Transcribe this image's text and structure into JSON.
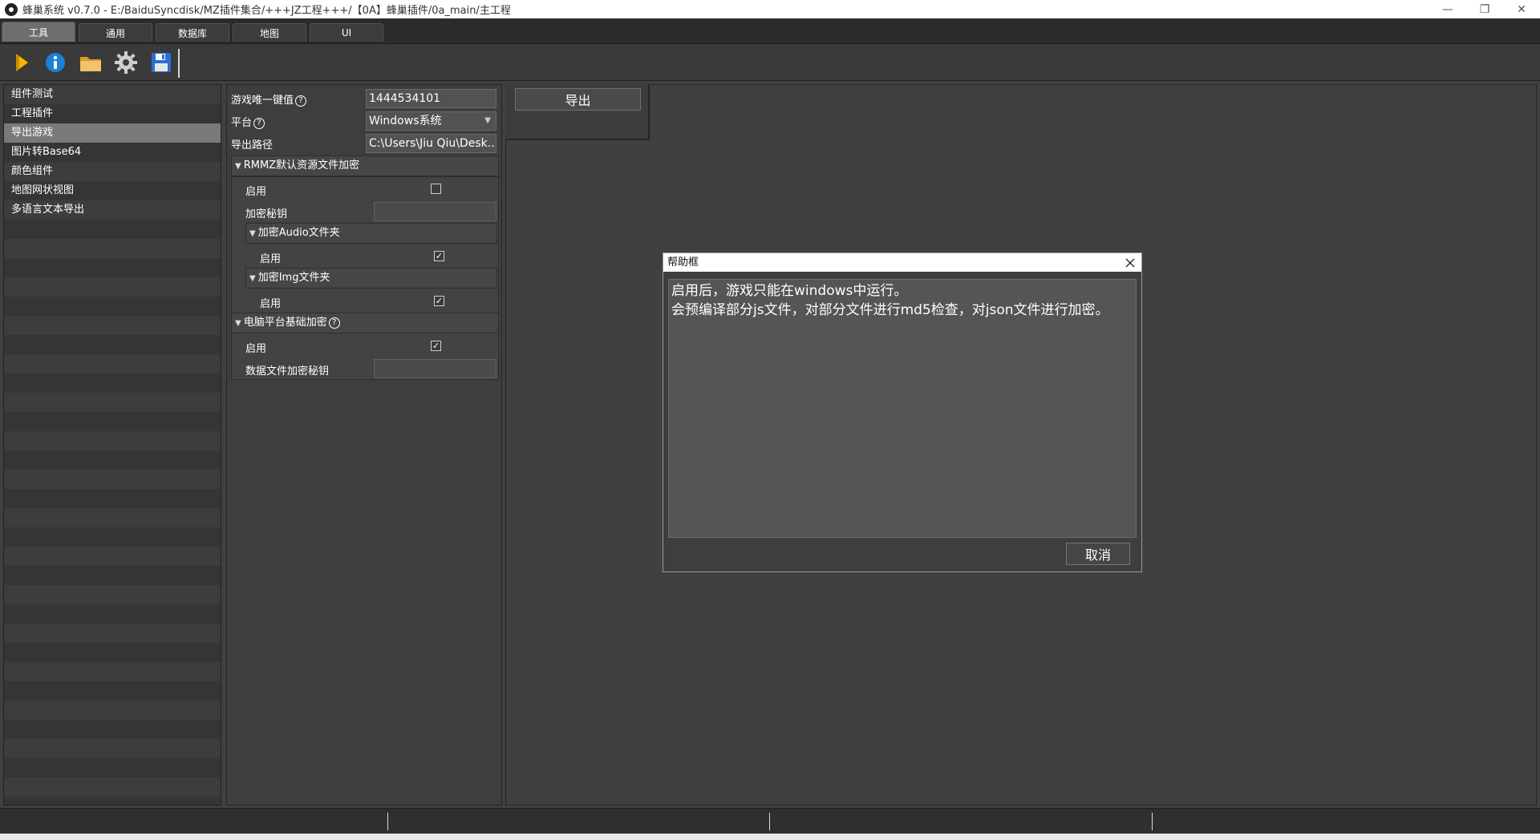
{
  "window": {
    "title": "蜂巢系统 v0.7.0 - E:/BaiduSyncdisk/MZ插件集合/+++JZ工程+++/【0A】蜂巢插件/0a_main/主工程",
    "minimize": "—",
    "restore": "❐",
    "close": "✕"
  },
  "tabs": [
    {
      "label": "工具",
      "active": true
    },
    {
      "label": "通用",
      "active": false
    },
    {
      "label": "数据库",
      "active": false
    },
    {
      "label": "地图",
      "active": false
    },
    {
      "label": "UI",
      "active": false
    }
  ],
  "toolbar": {
    "icons": [
      "play-icon",
      "info-icon",
      "folder-icon",
      "gear-icon",
      "save-icon"
    ],
    "colors": {
      "play": "#f5b800",
      "info": "#1e7fd6",
      "folder": "#e8b04a",
      "gear": "#d0d0d0",
      "save": "#2a6fd6"
    }
  },
  "sidebar": {
    "items": [
      {
        "label": "组件测试",
        "selected": false
      },
      {
        "label": "工程插件",
        "selected": false
      },
      {
        "label": "导出游戏",
        "selected": true
      },
      {
        "label": "图片转Base64",
        "selected": false
      },
      {
        "label": "颜色组件",
        "selected": false
      },
      {
        "label": "地图网状视图",
        "selected": false
      },
      {
        "label": "多语言文本导出",
        "selected": false
      }
    ]
  },
  "props": {
    "game_key_label": "游戏唯一键值",
    "game_key_value": "1444534101",
    "platform_label": "平台",
    "platform_value": "Windows系统",
    "export_path_label": "导出路径",
    "export_path_value": "C:\\Users\\Jiu Qiu\\Desk...",
    "rmmz_group": "RMMZ默认资源文件加密",
    "rmmz_enable_label": "启用",
    "rmmz_enable_checked": false,
    "key_label": "加密秘钥",
    "audio_group": "加密Audio文件夹",
    "audio_enable_label": "启用",
    "audio_enable_checked": true,
    "img_group": "加密Img文件夹",
    "img_enable_label": "启用",
    "img_enable_checked": true,
    "pc_group": "电脑平台基础加密",
    "pc_enable_label": "启用",
    "pc_enable_checked": true,
    "data_key_label": "数据文件加密秘钥"
  },
  "export": {
    "button_label": "导出"
  },
  "dialog": {
    "title": "帮助框",
    "line1": "启用后，游戏只能在windows中运行。",
    "line2": "会预编译部分js文件，对部分文件进行md5检查，对json文件进行加密。",
    "cancel_label": "取消"
  },
  "glyphs": {
    "check": "✓",
    "question": "?",
    "triangle": "▼",
    "dropdown": "▼"
  }
}
